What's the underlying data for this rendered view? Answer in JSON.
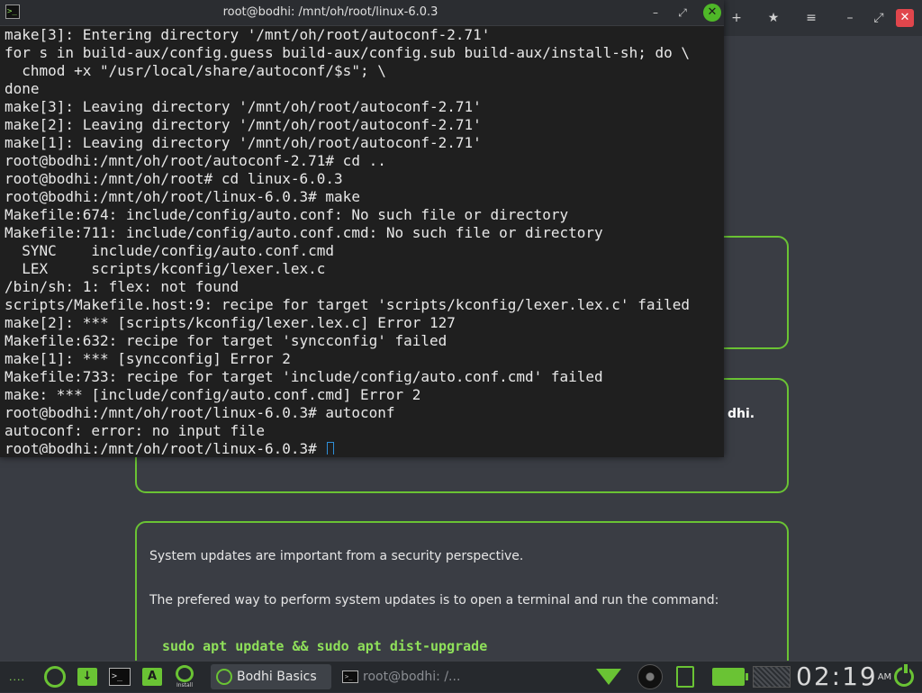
{
  "browser": {
    "buttons": {
      "new_tab": "+",
      "bookmark": "★",
      "menu": "≡",
      "minimize": "–",
      "restore": "⤢",
      "close": "✕"
    }
  },
  "cards": {
    "card2_fragment": "dhi.",
    "card3": {
      "p1": "System updates are important from a security perspective.",
      "p2": "The prefered way to perform system updates is to open a terminal and run the command:",
      "command": "sudo apt update && sudo apt dist-upgrade"
    }
  },
  "terminal": {
    "title": "root@bodhi: /mnt/oh/root/linux-6.0.3",
    "icon_text": ">_",
    "buttons": {
      "minimize": "–",
      "maximize": "⤢",
      "close": "✕"
    },
    "lines": [
      "make[3]: Entering directory '/mnt/oh/root/autoconf-2.71'",
      "for s in build-aux/config.guess build-aux/config.sub build-aux/install-sh; do \\",
      "  chmod +x \"/usr/local/share/autoconf/$s\"; \\",
      "done",
      "make[3]: Leaving directory '/mnt/oh/root/autoconf-2.71'",
      "make[2]: Leaving directory '/mnt/oh/root/autoconf-2.71'",
      "make[1]: Leaving directory '/mnt/oh/root/autoconf-2.71'",
      "root@bodhi:/mnt/oh/root/autoconf-2.71# cd ..",
      "root@bodhi:/mnt/oh/root# cd linux-6.0.3",
      "root@bodhi:/mnt/oh/root/linux-6.0.3# make",
      "Makefile:674: include/config/auto.conf: No such file or directory",
      "Makefile:711: include/config/auto.conf.cmd: No such file or directory",
      "  SYNC    include/config/auto.conf.cmd",
      "  LEX     scripts/kconfig/lexer.lex.c",
      "/bin/sh: 1: flex: not found",
      "scripts/Makefile.host:9: recipe for target 'scripts/kconfig/lexer.lex.c' failed",
      "make[2]: *** [scripts/kconfig/lexer.lex.c] Error 127",
      "Makefile:632: recipe for target 'syncconfig' failed",
      "make[1]: *** [syncconfig] Error 2",
      "Makefile:733: recipe for target 'include/config/auto.conf.cmd' failed",
      "make: *** [include/config/auto.conf.cmd] Error 2",
      "root@bodhi:/mnt/oh/root/linux-6.0.3# autoconf",
      "autoconf: error: no input file"
    ],
    "prompt": "root@bodhi:/mnt/oh/root/linux-6.0.3# "
  },
  "taskbar": {
    "dots": "....",
    "install_label": "Install",
    "task_bodhi": "Bodhi Basics",
    "task_terminal": "root@bodhi: /...",
    "clock_time": "02:19",
    "clock_ampm": "AM",
    "accent": "#6ac334"
  }
}
